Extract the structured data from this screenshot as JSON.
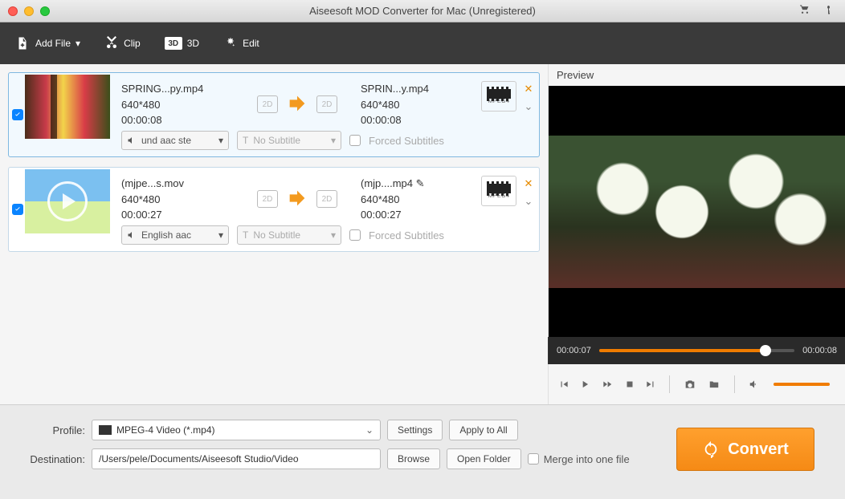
{
  "window": {
    "title": "Aiseesoft MOD Converter for Mac (Unregistered)"
  },
  "toolbar": {
    "add_file": "Add File",
    "clip": "Clip",
    "three_d": "3D",
    "edit": "Edit"
  },
  "items": [
    {
      "checked": true,
      "src": {
        "name": "SPRING...py.mp4",
        "resolution": "640*480",
        "duration": "00:00:08"
      },
      "dst": {
        "name": "SPRIN...y.mp4",
        "resolution": "640*480",
        "duration": "00:00:08"
      },
      "audio": "und aac ste",
      "subtitle": "No Subtitle",
      "forced": "Forced Subtitles",
      "profile_badge": "MPEG4"
    },
    {
      "checked": true,
      "src": {
        "name": "(mjpe...s.mov",
        "resolution": "640*480",
        "duration": "00:00:27"
      },
      "dst": {
        "name": "(mjp....mp4",
        "resolution": "640*480",
        "duration": "00:00:27"
      },
      "audio": "English aac",
      "subtitle": "No Subtitle",
      "forced": "Forced Subtitles",
      "profile_badge": "MPEG4"
    }
  ],
  "badge2d": "2D",
  "preview": {
    "label": "Preview",
    "current": "00:00:07",
    "total": "00:00:08"
  },
  "bottom": {
    "profile_label": "Profile:",
    "profile_value": "MPEG-4 Video (*.mp4)",
    "settings": "Settings",
    "apply_all": "Apply to All",
    "dest_label": "Destination:",
    "dest_value": "/Users/pele/Documents/Aiseesoft Studio/Video",
    "browse": "Browse",
    "open_folder": "Open Folder",
    "merge": "Merge into one file",
    "convert": "Convert"
  }
}
